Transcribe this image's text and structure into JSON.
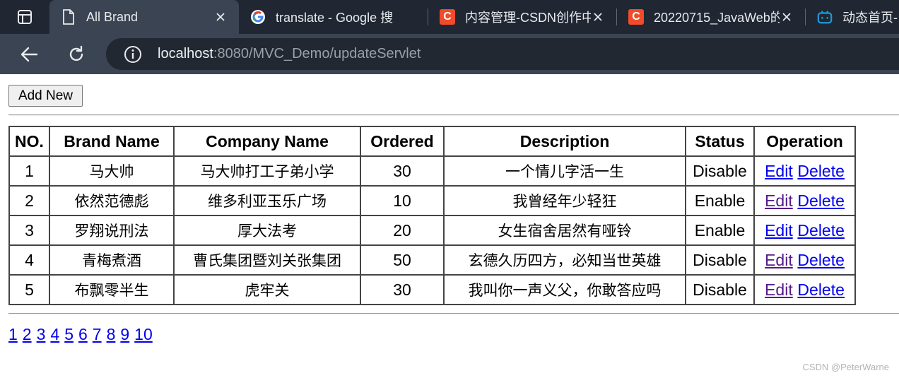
{
  "browser": {
    "tabs": [
      {
        "title": "All Brand",
        "favicon": "page-icon",
        "active": true
      },
      {
        "title": "translate - Google 搜",
        "favicon": "google-icon",
        "active": false
      },
      {
        "title": "内容管理-CSDN创作中",
        "favicon": "csdn-icon",
        "active": false
      },
      {
        "title": "20220715_JavaWeb的",
        "favicon": "csdn-icon",
        "active": false
      },
      {
        "title": "动态首页-",
        "favicon": "bilibili-icon",
        "active": false
      }
    ],
    "csdn_letter": "C",
    "url_host": "localhost",
    "url_path": ":8080/MVC_Demo/updateServlet"
  },
  "page": {
    "add_button": "Add New",
    "columns": [
      "NO.",
      "Brand Name",
      "Company Name",
      "Ordered",
      "Description",
      "Status",
      "Operation"
    ],
    "rows": [
      {
        "no": "1",
        "brand": "马大帅",
        "company": "马大帅打工子弟小学",
        "ordered": "30",
        "description": "一个情儿字活一生",
        "status": "Disable",
        "edit_visited": false
      },
      {
        "no": "2",
        "brand": "依然范德彪",
        "company": "维多利亚玉乐广场",
        "ordered": "10",
        "description": "我曾经年少轻狂",
        "status": "Enable",
        "edit_visited": true
      },
      {
        "no": "3",
        "brand": "罗翔说刑法",
        "company": "厚大法考",
        "ordered": "20",
        "description": "女生宿舍居然有哑铃",
        "status": "Enable",
        "edit_visited": false
      },
      {
        "no": "4",
        "brand": "青梅煮酒",
        "company": "曹氏集团暨刘关张集团",
        "ordered": "50",
        "description": "玄德久历四方，必知当世英雄",
        "status": "Disable",
        "edit_visited": true
      },
      {
        "no": "5",
        "brand": "布飘零半生",
        "company": "虎牢关",
        "ordered": "30",
        "description": "我叫你一声义父，你敢答应吗",
        "status": "Disable",
        "edit_visited": true
      }
    ],
    "edit_label": "Edit",
    "delete_label": "Delete",
    "pages": [
      "1",
      "2",
      "3",
      "4",
      "5",
      "6",
      "7",
      "8",
      "9",
      "10"
    ]
  },
  "watermark": "CSDN @PeterWarne",
  "colors": {
    "link": "#0000ee",
    "visited_link": "#551a8b",
    "tabstrip": "#202733",
    "toolbar": "#3b4452"
  }
}
